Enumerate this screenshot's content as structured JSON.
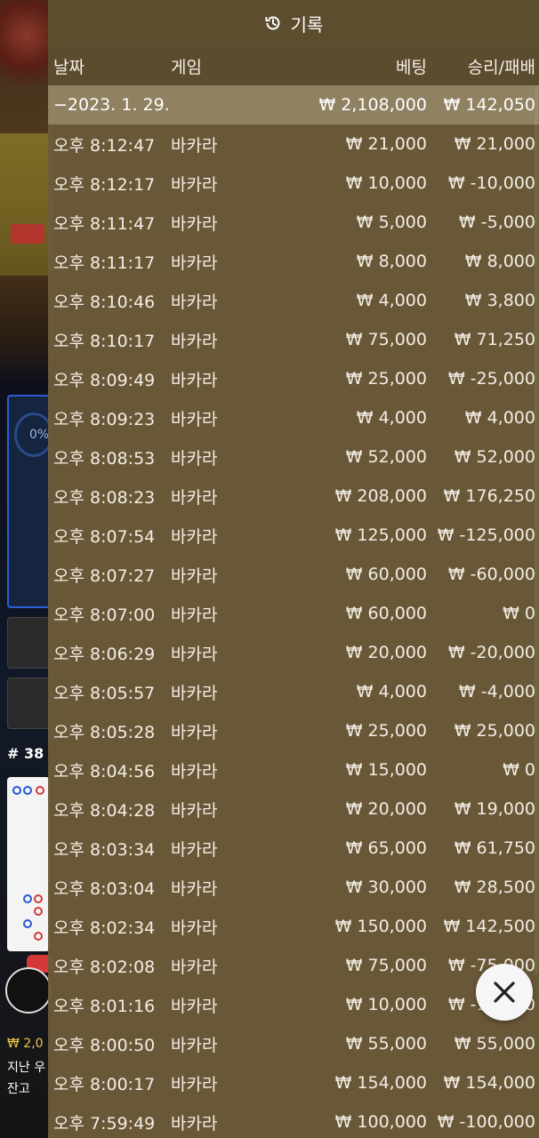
{
  "header": {
    "title": "기록",
    "icon": "history-icon"
  },
  "columns": {
    "date": "날짜",
    "game": "게임",
    "bet": "베팅",
    "result": "승리/패배"
  },
  "summary": {
    "date": "−2023. 1. 29.",
    "bet": "₩ 2,108,000",
    "result": "₩ 142,050"
  },
  "rows": [
    {
      "time": "오후 8:12:47",
      "game": "바카라",
      "bet": "₩ 21,000",
      "result": "₩ 21,000"
    },
    {
      "time": "오후 8:12:17",
      "game": "바카라",
      "bet": "₩ 10,000",
      "result": "₩ -10,000"
    },
    {
      "time": "오후 8:11:47",
      "game": "바카라",
      "bet": "₩ 5,000",
      "result": "₩ -5,000"
    },
    {
      "time": "오후 8:11:17",
      "game": "바카라",
      "bet": "₩ 8,000",
      "result": "₩ 8,000"
    },
    {
      "time": "오후 8:10:46",
      "game": "바카라",
      "bet": "₩ 4,000",
      "result": "₩ 3,800"
    },
    {
      "time": "오후 8:10:17",
      "game": "바카라",
      "bet": "₩ 75,000",
      "result": "₩ 71,250"
    },
    {
      "time": "오후 8:09:49",
      "game": "바카라",
      "bet": "₩ 25,000",
      "result": "₩ -25,000"
    },
    {
      "time": "오후 8:09:23",
      "game": "바카라",
      "bet": "₩ 4,000",
      "result": "₩ 4,000"
    },
    {
      "time": "오후 8:08:53",
      "game": "바카라",
      "bet": "₩ 52,000",
      "result": "₩ 52,000"
    },
    {
      "time": "오후 8:08:23",
      "game": "바카라",
      "bet": "₩ 208,000",
      "result": "₩ 176,250"
    },
    {
      "time": "오후 8:07:54",
      "game": "바카라",
      "bet": "₩ 125,000",
      "result": "₩ -125,000"
    },
    {
      "time": "오후 8:07:27",
      "game": "바카라",
      "bet": "₩ 60,000",
      "result": "₩ -60,000"
    },
    {
      "time": "오후 8:07:00",
      "game": "바카라",
      "bet": "₩ 60,000",
      "result": "₩ 0"
    },
    {
      "time": "오후 8:06:29",
      "game": "바카라",
      "bet": "₩ 20,000",
      "result": "₩ -20,000"
    },
    {
      "time": "오후 8:05:57",
      "game": "바카라",
      "bet": "₩ 4,000",
      "result": "₩ -4,000"
    },
    {
      "time": "오후 8:05:28",
      "game": "바카라",
      "bet": "₩ 25,000",
      "result": "₩ 25,000"
    },
    {
      "time": "오후 8:04:56",
      "game": "바카라",
      "bet": "₩ 15,000",
      "result": "₩ 0"
    },
    {
      "time": "오후 8:04:28",
      "game": "바카라",
      "bet": "₩ 20,000",
      "result": "₩ 19,000"
    },
    {
      "time": "오후 8:03:34",
      "game": "바카라",
      "bet": "₩ 65,000",
      "result": "₩ 61,750"
    },
    {
      "time": "오후 8:03:04",
      "game": "바카라",
      "bet": "₩ 30,000",
      "result": "₩ 28,500"
    },
    {
      "time": "오후 8:02:34",
      "game": "바카라",
      "bet": "₩ 150,000",
      "result": "₩ 142,500"
    },
    {
      "time": "오후 8:02:08",
      "game": "바카라",
      "bet": "₩ 75,000",
      "result": "₩ -75,000"
    },
    {
      "time": "오후 8:01:16",
      "game": "바카라",
      "bet": "₩ 10,000",
      "result": "₩ -10,000"
    },
    {
      "time": "오후 8:00:50",
      "game": "바카라",
      "bet": "₩ 55,000",
      "result": "₩ 55,000"
    },
    {
      "time": "오후 8:00:17",
      "game": "바카라",
      "bet": "₩ 154,000",
      "result": "₩ 154,000"
    },
    {
      "time": "오후 7:59:49",
      "game": "바카라",
      "bet": "₩ 100,000",
      "result": "₩ -100,000"
    }
  ],
  "background": {
    "percent": "0%",
    "round_number": "# 38",
    "new_badge": "신",
    "balance_partial": "₩ 2,0",
    "last_label": "지난 우",
    "balance_label": "잔고"
  },
  "close_button": {
    "icon": "close-icon"
  }
}
